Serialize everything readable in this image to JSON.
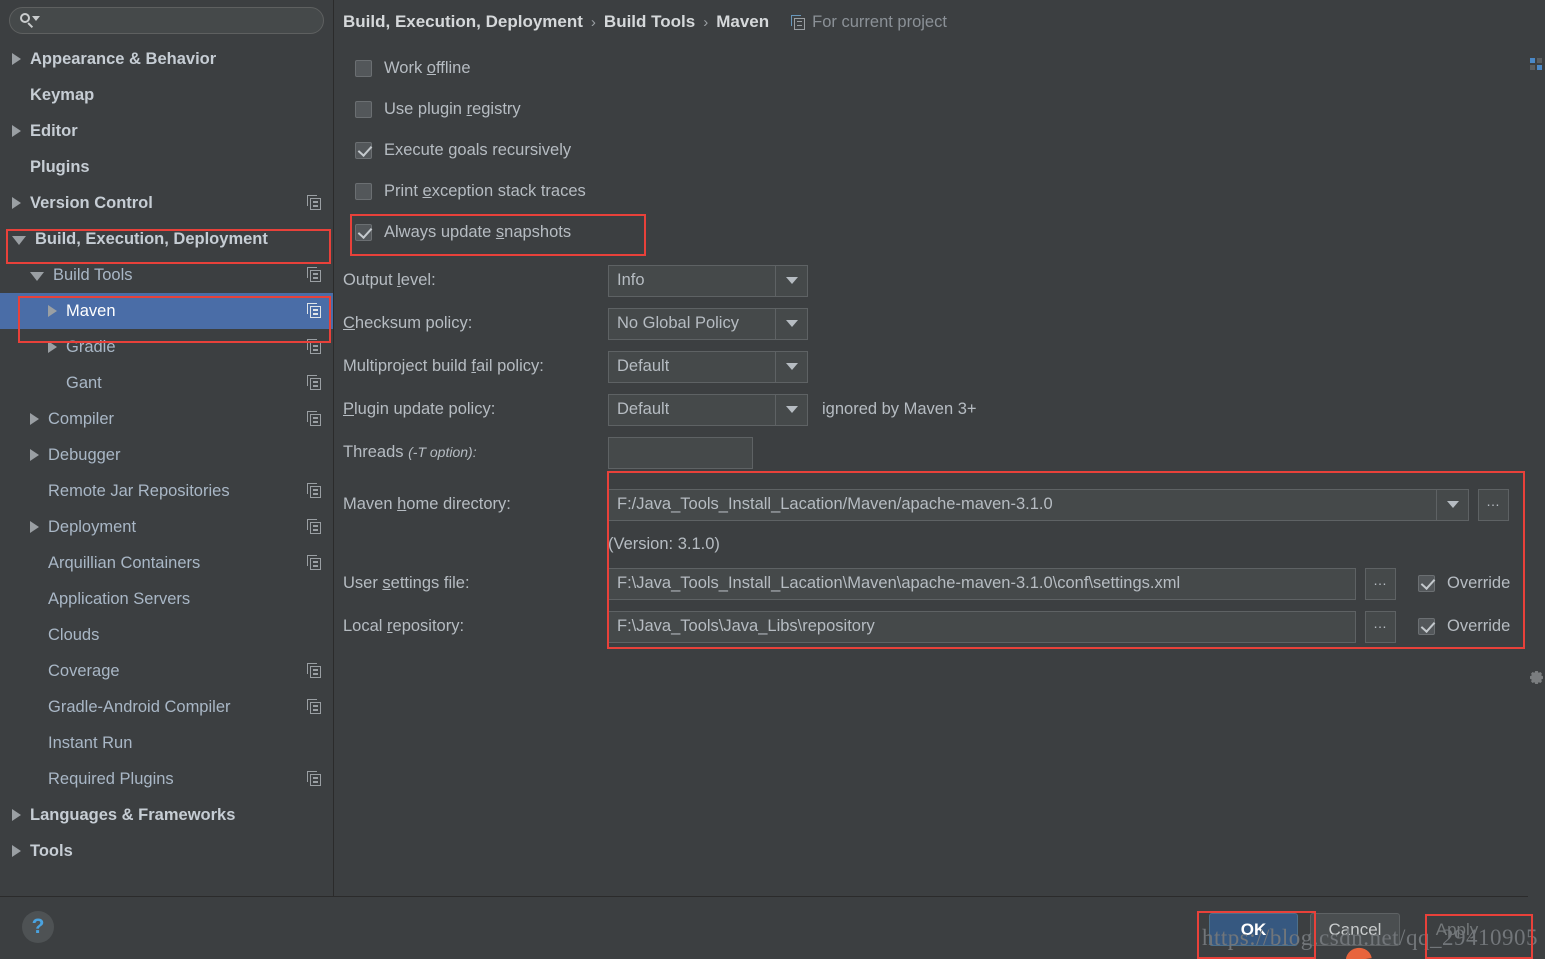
{
  "search": {
    "placeholder": "",
    "value": ""
  },
  "sidebar": {
    "items": [
      {
        "label": "Appearance & Behavior",
        "indent": 0,
        "arrow": "right",
        "bold": true,
        "icon": false,
        "selected": false
      },
      {
        "label": "Keymap",
        "indent": 0,
        "arrow": "none",
        "bold": true,
        "icon": false,
        "selected": false
      },
      {
        "label": "Editor",
        "indent": 0,
        "arrow": "right",
        "bold": true,
        "icon": false,
        "selected": false
      },
      {
        "label": "Plugins",
        "indent": 0,
        "arrow": "none",
        "bold": true,
        "icon": false,
        "selected": false
      },
      {
        "label": "Version Control",
        "indent": 0,
        "arrow": "right",
        "bold": true,
        "icon": true,
        "selected": false
      },
      {
        "label": "Build, Execution, Deployment",
        "indent": 0,
        "arrow": "down",
        "bold": true,
        "icon": false,
        "selected": false
      },
      {
        "label": "Build Tools",
        "indent": 1,
        "arrow": "down",
        "bold": false,
        "icon": true,
        "selected": false
      },
      {
        "label": "Maven",
        "indent": 2,
        "arrow": "right",
        "bold": false,
        "icon": true,
        "selected": true
      },
      {
        "label": "Gradle",
        "indent": 2,
        "arrow": "right",
        "bold": false,
        "icon": true,
        "selected": false
      },
      {
        "label": "Gant",
        "indent": 2,
        "arrow": "none",
        "bold": false,
        "icon": true,
        "selected": false
      },
      {
        "label": "Compiler",
        "indent": 1,
        "arrow": "right",
        "bold": false,
        "icon": true,
        "selected": false
      },
      {
        "label": "Debugger",
        "indent": 1,
        "arrow": "right",
        "bold": false,
        "icon": false,
        "selected": false
      },
      {
        "label": "Remote Jar Repositories",
        "indent": 1,
        "arrow": "none",
        "bold": false,
        "icon": true,
        "selected": false
      },
      {
        "label": "Deployment",
        "indent": 1,
        "arrow": "right",
        "bold": false,
        "icon": true,
        "selected": false
      },
      {
        "label": "Arquillian Containers",
        "indent": 1,
        "arrow": "none",
        "bold": false,
        "icon": true,
        "selected": false
      },
      {
        "label": "Application Servers",
        "indent": 1,
        "arrow": "none",
        "bold": false,
        "icon": false,
        "selected": false
      },
      {
        "label": "Clouds",
        "indent": 1,
        "arrow": "none",
        "bold": false,
        "icon": false,
        "selected": false
      },
      {
        "label": "Coverage",
        "indent": 1,
        "arrow": "none",
        "bold": false,
        "icon": true,
        "selected": false
      },
      {
        "label": "Gradle-Android Compiler",
        "indent": 1,
        "arrow": "none",
        "bold": false,
        "icon": true,
        "selected": false
      },
      {
        "label": "Instant Run",
        "indent": 1,
        "arrow": "none",
        "bold": false,
        "icon": false,
        "selected": false
      },
      {
        "label": "Required Plugins",
        "indent": 1,
        "arrow": "none",
        "bold": false,
        "icon": true,
        "selected": false
      },
      {
        "label": "Languages & Frameworks",
        "indent": 0,
        "arrow": "right",
        "bold": true,
        "icon": false,
        "selected": false
      },
      {
        "label": "Tools",
        "indent": 0,
        "arrow": "right",
        "bold": true,
        "icon": false,
        "selected": false
      }
    ]
  },
  "breadcrumb": {
    "part1": "Build, Execution, Deployment",
    "sep1": "›",
    "part2": "Build Tools",
    "sep2": "›",
    "part3": "Maven",
    "scope": "For current project"
  },
  "checkboxes": [
    {
      "label_pre": "Work ",
      "label_mn": "o",
      "label_post": "ffline",
      "checked": false
    },
    {
      "label_pre": "Use plugin ",
      "label_mn": "r",
      "label_post": "egistry",
      "checked": false
    },
    {
      "label_pre": "Execute ",
      "label_mn": "g",
      "label_post": "oals recursively",
      "checked": true
    },
    {
      "label_pre": "Print ",
      "label_mn": "e",
      "label_post": "xception stack traces",
      "checked": false
    },
    {
      "label_pre": "Always update ",
      "label_mn": "s",
      "label_post": "napshots",
      "checked": true
    }
  ],
  "fields": {
    "output_level": {
      "label_pre": "Output ",
      "label_mn": "l",
      "label_post": "evel:",
      "value": "Info"
    },
    "checksum": {
      "label_pre": "",
      "label_mn": "C",
      "label_post": "hecksum policy:",
      "value": "No Global Policy"
    },
    "multiproject": {
      "label_pre": "Multiproject build ",
      "label_mn": "f",
      "label_post": "ail policy:",
      "value": "Default"
    },
    "plugin_update": {
      "label_pre": "",
      "label_mn": "P",
      "label_post": "lugin update policy:",
      "value": "Default",
      "hint": "ignored by Maven 3+"
    },
    "threads": {
      "label_pre": "Threads ",
      "label_it": "(-T option):",
      "value": ""
    },
    "maven_home": {
      "label_pre": "Maven ",
      "label_mn": "h",
      "label_post": "ome directory:",
      "value": "F:/Java_Tools_Install_Lacation/Maven/apache-maven-3.1.0"
    },
    "version_text": "(Version: 3.1.0)",
    "user_settings": {
      "label_pre": "User ",
      "label_mn": "s",
      "label_post": "ettings file:",
      "value": "F:\\Java_Tools_Install_Lacation\\Maven\\apache-maven-3.1.0\\conf\\settings.xml",
      "override_label": "Override",
      "override_checked": true
    },
    "local_repo": {
      "label_pre": "Local ",
      "label_mn": "r",
      "label_post": "epository:",
      "value": "F:\\Java_Tools\\Java_Libs\\repository",
      "override_label": "Override",
      "override_checked": true
    },
    "browse_label": "…"
  },
  "bottom": {
    "help_label": "?",
    "ok_label": "OK",
    "cancel_label": "Cancel",
    "apply_label": "Apply"
  },
  "watermark": {
    "text": "https://blog.csdn.net/qq_29410905"
  },
  "colors": {
    "background": "#3c3f41",
    "selection": "#4a6da7",
    "accent_blue": "#3592c4",
    "annotation_red": "#e8413a",
    "primary_button": "#365880",
    "text": "#b6bcc2"
  }
}
